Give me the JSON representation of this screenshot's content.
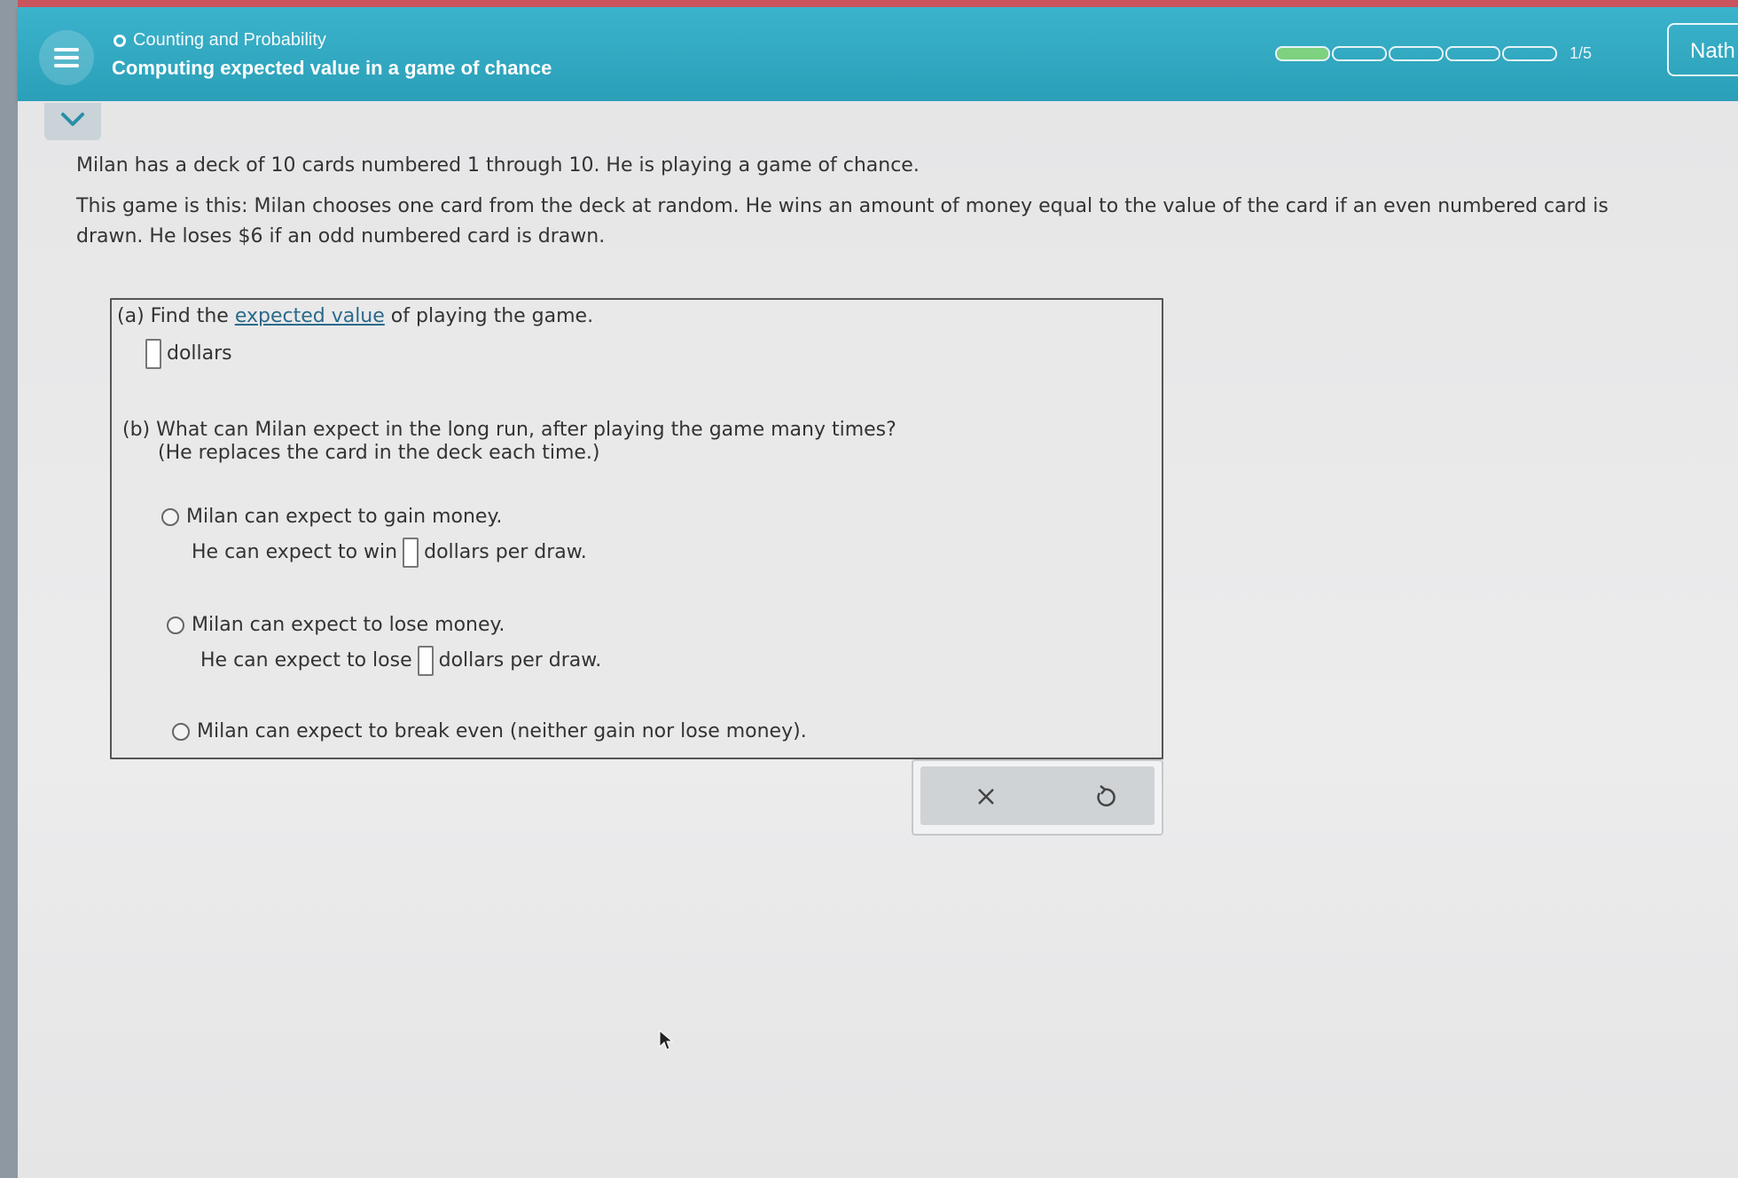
{
  "header": {
    "topic": "Counting and Probability",
    "lesson_title": "Computing expected value in a game of chance",
    "progress": {
      "current": 1,
      "total": 5,
      "label": "1/5"
    },
    "user_name": "Nath"
  },
  "question": {
    "line1": "Milan has a deck of 10 cards numbered 1 through 10. He is playing a game of chance.",
    "line2": "This game is this: Milan chooses one card from the deck at random. He wins an amount of money equal to the value of the card if an even numbered card is drawn. He loses $6 if an odd numbered card is drawn."
  },
  "part_a": {
    "prefix": "(a) Find the",
    "link": "expected value",
    "suffix": "of playing the game.",
    "unit": "dollars",
    "value": ""
  },
  "part_b": {
    "prompt": "(b) What can Milan expect in the long run, after playing the game many times?",
    "note": "(He replaces the card in the deck each time.)",
    "options": [
      {
        "label": "Milan can expect to gain money.",
        "sub_prefix": "He can expect to win",
        "sub_suffix": "dollars per draw."
      },
      {
        "label": "Milan can expect to lose money.",
        "sub_prefix": "He can expect to lose",
        "sub_suffix": "dollars per draw."
      },
      {
        "label": "Milan can expect to break even (neither gain nor lose money)."
      }
    ]
  },
  "actions": {
    "clear_icon": "close-icon",
    "reset_icon": "undo-icon"
  }
}
